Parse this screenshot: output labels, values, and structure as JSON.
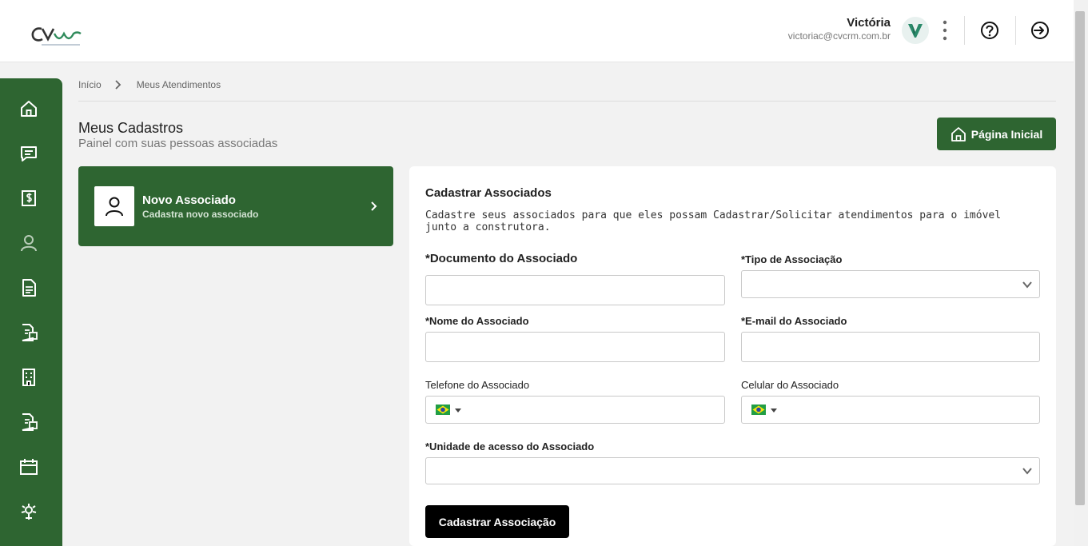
{
  "header": {
    "logo_alt": "CVcrm",
    "user_name": "Victória",
    "user_email": "victoriac@cvcrm.com.br",
    "icons": [
      "avatar-logo",
      "kebab-menu-icon",
      "help-icon",
      "logout-icon"
    ]
  },
  "sidebar": {
    "items": [
      {
        "name": "home-icon"
      },
      {
        "name": "chat-icon"
      },
      {
        "name": "finance-icon"
      },
      {
        "name": "user-icon"
      },
      {
        "name": "document-icon"
      },
      {
        "name": "contract-icon"
      },
      {
        "name": "building-icon"
      },
      {
        "name": "report-icon"
      },
      {
        "name": "calendar-icon"
      },
      {
        "name": "tools-icon"
      }
    ]
  },
  "breadcrumb": {
    "home": "Início",
    "current": "Meus Atendimentos"
  },
  "page": {
    "title": "Meus Cadastros",
    "subtitle": "Painel com suas pessoas associadas",
    "home_button": "Página Inicial"
  },
  "novo_card": {
    "title": "Novo Associado",
    "subtitle": "Cadastra novo associado"
  },
  "form": {
    "title": "Cadastrar Associados",
    "description": "Cadastre seus associados para que eles possam Cadastrar/Solicitar atendimentos para o imóvel junto a construtora.",
    "documento_label": "*Documento do Associado",
    "tipo_label": "*Tipo de Associação",
    "nome_label": "*Nome do Associado",
    "email_label": "*E-mail do Associado",
    "telefone_label": "Telefone do Associado",
    "celular_label": "Celular do Associado",
    "unidade_label": "*Unidade de acesso do Associado",
    "submit_label": "Cadastrar Associação"
  },
  "colors": {
    "brand_green": "#2e6531",
    "submit_black": "#000000"
  }
}
